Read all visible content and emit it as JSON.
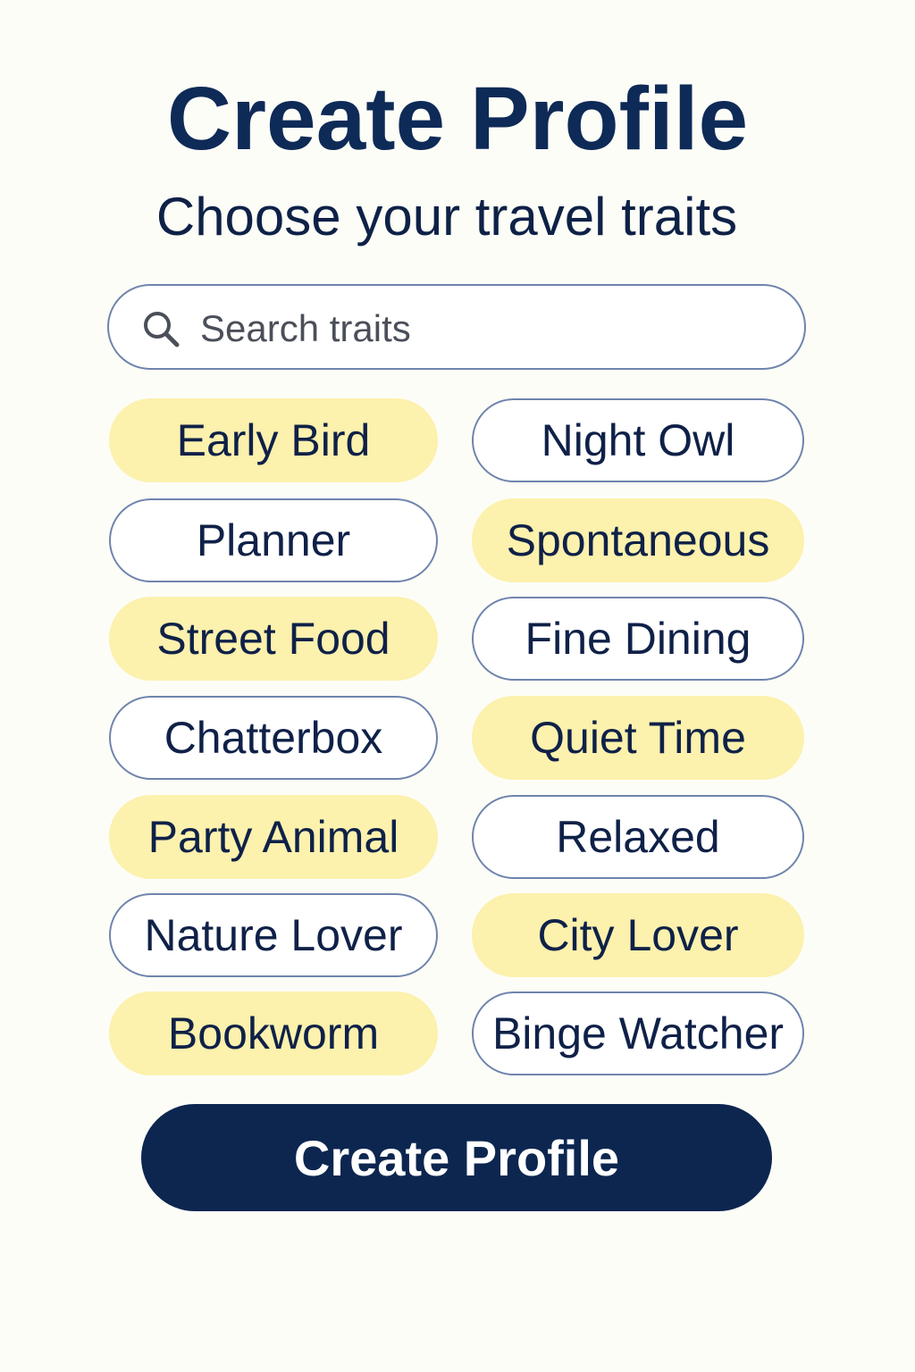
{
  "header": {
    "title": "Create Profile",
    "subtitle": "Choose your travel traits"
  },
  "search": {
    "placeholder": "Search traits",
    "value": "",
    "icon": "search-icon"
  },
  "traits": [
    {
      "label": "Early Bird",
      "selected": true
    },
    {
      "label": "Night Owl",
      "selected": false
    },
    {
      "label": "Planner",
      "selected": false
    },
    {
      "label": "Spontaneous",
      "selected": true
    },
    {
      "label": "Street Food",
      "selected": true
    },
    {
      "label": "Fine Dining",
      "selected": false
    },
    {
      "label": "Chatterbox",
      "selected": false
    },
    {
      "label": "Quiet Time",
      "selected": true
    },
    {
      "label": "Party Animal",
      "selected": true
    },
    {
      "label": "Relaxed",
      "selected": false
    },
    {
      "label": "Nature Lover",
      "selected": false
    },
    {
      "label": "City Lover",
      "selected": true
    },
    {
      "label": "Bookworm",
      "selected": true
    },
    {
      "label": "Binge Watcher",
      "selected": false
    }
  ],
  "actions": {
    "create_label": "Create Profile"
  },
  "colors": {
    "navy": "#0c2650",
    "selected_chip": "#fcf1ad",
    "chip_border": "#6f84ad",
    "background": "#fdfdf7"
  }
}
